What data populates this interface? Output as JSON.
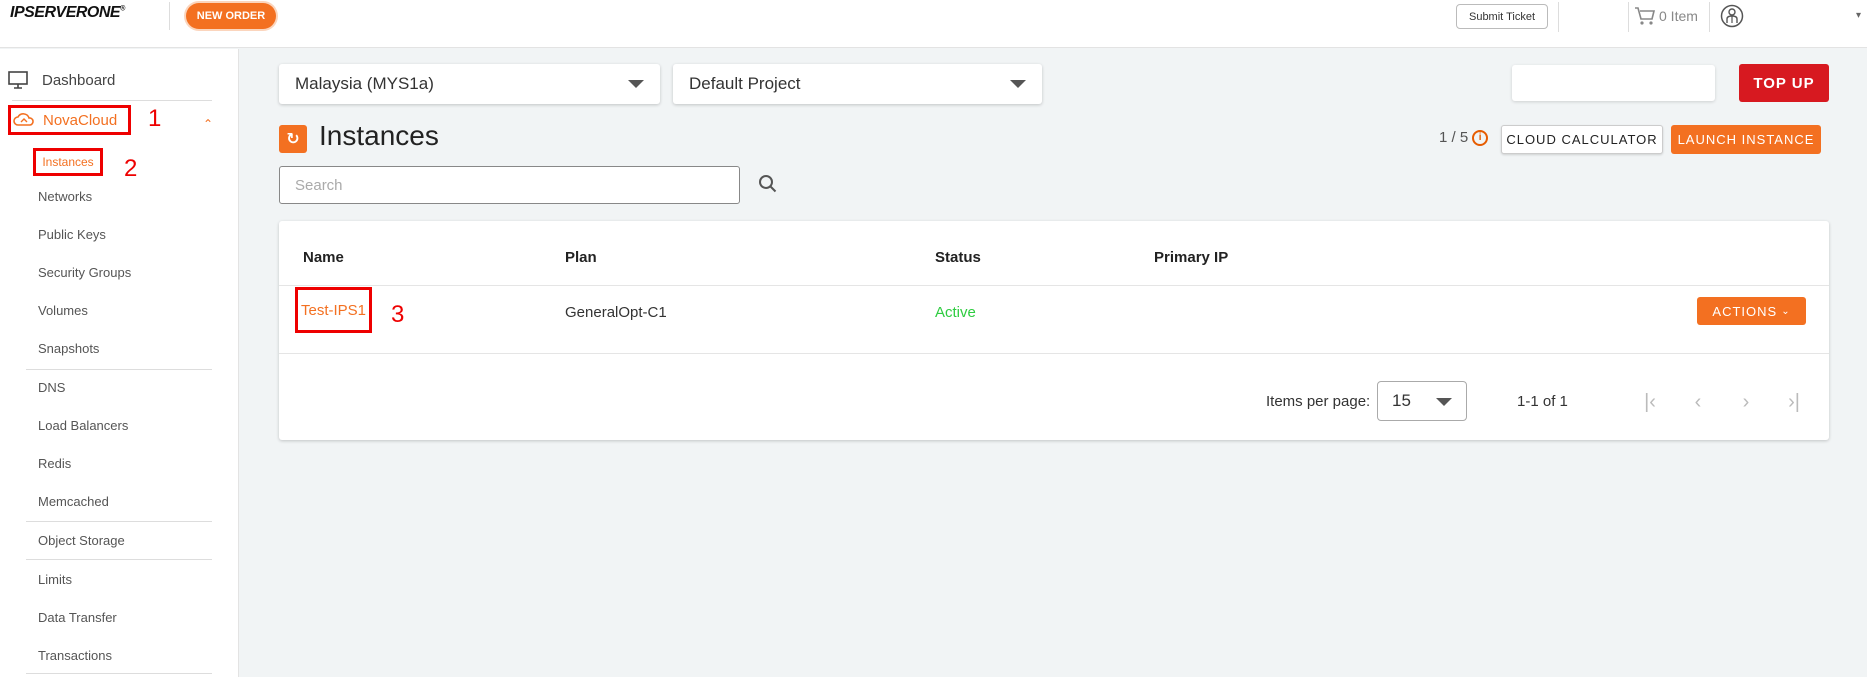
{
  "header": {
    "logo": "IPSERVERONE",
    "logo_mark": "®",
    "new_order": "NEW ORDER",
    "submit_ticket": "Submit Ticket",
    "cart_label": "0 Item"
  },
  "sidebar": {
    "dashboard": "Dashboard",
    "novacloud": "NovaCloud",
    "items": [
      "Instances",
      "Networks",
      "Public Keys",
      "Security Groups",
      "Volumes",
      "Snapshots",
      "DNS",
      "Load Balancers",
      "Redis",
      "Memcached",
      "Object Storage",
      "Limits",
      "Data Transfer",
      "Transactions"
    ]
  },
  "annotations": {
    "a1": "1",
    "a2": "2",
    "a3": "3"
  },
  "main": {
    "region": "Malaysia (MYS1a)",
    "project": "Default Project",
    "top_up": "TOP UP",
    "title": "Instances",
    "quota": "1 / 5",
    "cloud_calculator": "CLOUD CALCULATOR",
    "launch_instance": "LAUNCH INSTANCE",
    "search_placeholder": "Search",
    "table": {
      "headers": [
        "Name",
        "Plan",
        "Status",
        "Primary IP"
      ],
      "rows": [
        {
          "name": "Test-IPS1",
          "plan": "GeneralOpt-C1",
          "status": "Active",
          "primary_ip": ""
        }
      ],
      "actions": "ACTIONS"
    },
    "pagination": {
      "label": "Items per page:",
      "per_page": "15",
      "range": "1-1 of 1"
    }
  },
  "colors": {
    "accent": "#f37021",
    "topup": "#d71920",
    "active": "#2ecc40",
    "annotation": "#ee0000"
  }
}
